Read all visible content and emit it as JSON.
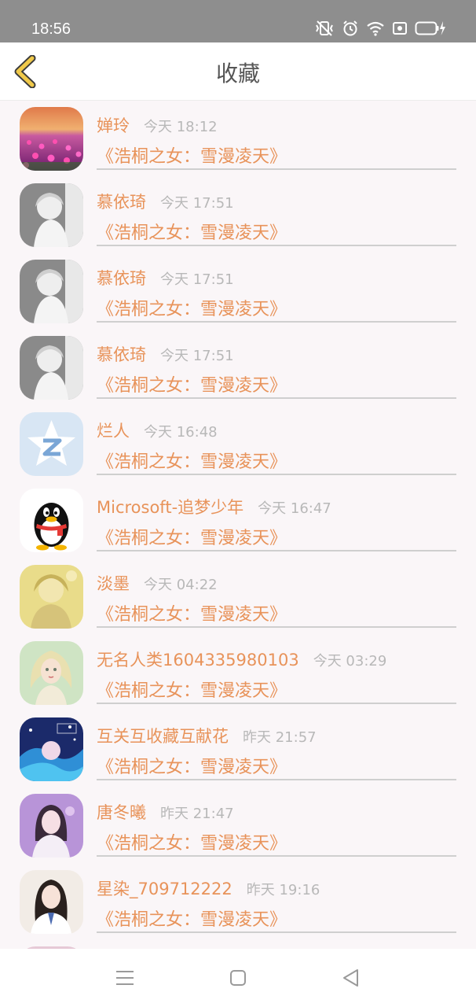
{
  "status": {
    "time": "18:56"
  },
  "header": {
    "title": "收藏"
  },
  "items": [
    {
      "name": "婵玲",
      "time": "今天 18:12",
      "book": "《浩桐之女：雪漫凌天》",
      "avatar": "tulip-field-avatar"
    },
    {
      "name": "慕依琦",
      "time": "今天 17:51",
      "book": "《浩桐之女：雪漫凌天》",
      "avatar": "anime-girl-gray-avatar"
    },
    {
      "name": "慕依琦",
      "time": "今天 17:51",
      "book": "《浩桐之女：雪漫凌天》",
      "avatar": "anime-girl-gray-avatar"
    },
    {
      "name": "慕依琦",
      "time": "今天 17:51",
      "book": "《浩桐之女：雪漫凌天》",
      "avatar": "anime-girl-gray-avatar"
    },
    {
      "name": "烂人",
      "time": "今天 16:48",
      "book": "《浩桐之女：雪漫凌天》",
      "avatar": "qzone-star-avatar"
    },
    {
      "name": "Microsoft-追梦少年",
      "time": "今天 16:47",
      "book": "《浩桐之女：雪漫凌天》",
      "avatar": "qq-penguin-avatar"
    },
    {
      "name": "淡墨",
      "time": "今天 04:22",
      "book": "《浩桐之女：雪漫凌天》",
      "avatar": "yellow-portrait-avatar"
    },
    {
      "name": "无名人类1604335980103",
      "time": "今天 03:29",
      "book": "《浩桐之女：雪漫凌天》",
      "avatar": "fairy-girl-avatar"
    },
    {
      "name": "互关互收藏互献花",
      "time": "昨天 21:57",
      "book": "《浩桐之女：雪漫凌天》",
      "avatar": "blue-anime-avatar"
    },
    {
      "name": "唐冬曦",
      "time": "昨天 21:47",
      "book": "《浩桐之女：雪漫凌天》",
      "avatar": "purple-girl-avatar"
    },
    {
      "name": "星染_709712222",
      "time": "昨天 19:16",
      "book": "《浩桐之女：雪漫凌天》",
      "avatar": "school-girl-avatar"
    }
  ],
  "colors": {
    "accent": "#e8935a",
    "time": "#b8b8b8",
    "status_bar": "#8e8e8e",
    "back_arrow": "#f0c94a"
  }
}
